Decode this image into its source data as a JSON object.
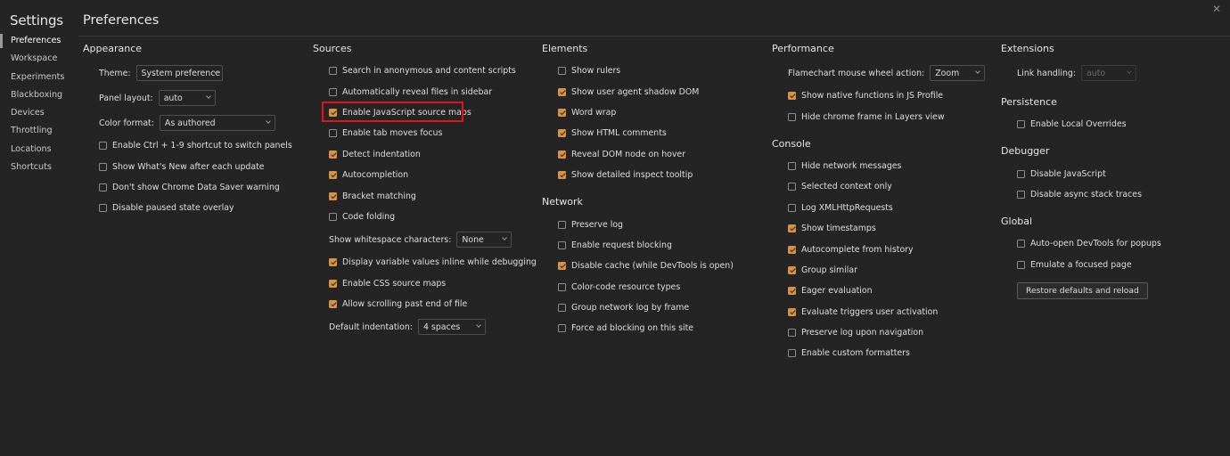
{
  "sidebar": {
    "title": "Settings",
    "items": [
      {
        "label": "Preferences",
        "active": true
      },
      {
        "label": "Workspace"
      },
      {
        "label": "Experiments"
      },
      {
        "label": "Blackboxing"
      },
      {
        "label": "Devices"
      },
      {
        "label": "Throttling"
      },
      {
        "label": "Locations"
      },
      {
        "label": "Shortcuts"
      }
    ]
  },
  "header": {
    "title": "Preferences",
    "close_icon": "close-icon"
  },
  "columns": [
    {
      "sections": [
        {
          "title": "Appearance",
          "rows": [
            {
              "type": "select",
              "label": "Theme:",
              "value": "System preference"
            },
            {
              "type": "select",
              "label": "Panel layout:",
              "value": "auto"
            },
            {
              "type": "select",
              "label": "Color format:",
              "value": "As authored"
            },
            {
              "type": "checkbox",
              "label": "Enable Ctrl + 1-9 shortcut to switch panels",
              "checked": false
            },
            {
              "type": "checkbox",
              "label": "Show What's New after each update",
              "checked": false
            },
            {
              "type": "checkbox",
              "label": "Don't show Chrome Data Saver warning",
              "checked": false
            },
            {
              "type": "checkbox",
              "label": "Disable paused state overlay",
              "checked": false
            }
          ]
        }
      ]
    },
    {
      "sections": [
        {
          "title": "Sources",
          "rows": [
            {
              "type": "checkbox",
              "label": "Search in anonymous and content scripts",
              "checked": false
            },
            {
              "type": "checkbox",
              "label": "Automatically reveal files in sidebar",
              "checked": false
            },
            {
              "type": "checkbox",
              "label": "Enable JavaScript source maps",
              "checked": true,
              "highlighted": true
            },
            {
              "type": "checkbox",
              "label": "Enable tab moves focus",
              "checked": false
            },
            {
              "type": "checkbox",
              "label": "Detect indentation",
              "checked": true
            },
            {
              "type": "checkbox",
              "label": "Autocompletion",
              "checked": true
            },
            {
              "type": "checkbox",
              "label": "Bracket matching",
              "checked": true
            },
            {
              "type": "checkbox",
              "label": "Code folding",
              "checked": false
            },
            {
              "type": "select",
              "label": "Show whitespace characters:",
              "value": "None"
            },
            {
              "type": "checkbox",
              "label": "Display variable values inline while debugging",
              "checked": true
            },
            {
              "type": "checkbox",
              "label": "Enable CSS source maps",
              "checked": true
            },
            {
              "type": "checkbox",
              "label": "Allow scrolling past end of file",
              "checked": true
            },
            {
              "type": "select",
              "label": "Default indentation:",
              "value": "4 spaces"
            }
          ]
        }
      ]
    },
    {
      "sections": [
        {
          "title": "Elements",
          "rows": [
            {
              "type": "checkbox",
              "label": "Show rulers",
              "checked": false
            },
            {
              "type": "checkbox",
              "label": "Show user agent shadow DOM",
              "checked": true
            },
            {
              "type": "checkbox",
              "label": "Word wrap",
              "checked": true
            },
            {
              "type": "checkbox",
              "label": "Show HTML comments",
              "checked": true
            },
            {
              "type": "checkbox",
              "label": "Reveal DOM node on hover",
              "checked": true
            },
            {
              "type": "checkbox",
              "label": "Show detailed inspect tooltip",
              "checked": true
            }
          ]
        },
        {
          "title": "Network",
          "rows": [
            {
              "type": "checkbox",
              "label": "Preserve log",
              "checked": false
            },
            {
              "type": "checkbox",
              "label": "Enable request blocking",
              "checked": false
            },
            {
              "type": "checkbox",
              "label": "Disable cache (while DevTools is open)",
              "checked": true
            },
            {
              "type": "checkbox",
              "label": "Color-code resource types",
              "checked": false
            },
            {
              "type": "checkbox",
              "label": "Group network log by frame",
              "checked": false
            },
            {
              "type": "checkbox",
              "label": "Force ad blocking on this site",
              "checked": false
            }
          ]
        }
      ]
    },
    {
      "sections": [
        {
          "title": "Performance",
          "rows": [
            {
              "type": "select",
              "label": "Flamechart mouse wheel action:",
              "value": "Zoom"
            },
            {
              "type": "checkbox",
              "label": "Show native functions in JS Profile",
              "checked": true
            },
            {
              "type": "checkbox",
              "label": "Hide chrome frame in Layers view",
              "checked": false
            }
          ]
        },
        {
          "title": "Console",
          "rows": [
            {
              "type": "checkbox",
              "label": "Hide network messages",
              "checked": false
            },
            {
              "type": "checkbox",
              "label": "Selected context only",
              "checked": false
            },
            {
              "type": "checkbox",
              "label": "Log XMLHttpRequests",
              "checked": false
            },
            {
              "type": "checkbox",
              "label": "Show timestamps",
              "checked": true
            },
            {
              "type": "checkbox",
              "label": "Autocomplete from history",
              "checked": true
            },
            {
              "type": "checkbox",
              "label": "Group similar",
              "checked": true
            },
            {
              "type": "checkbox",
              "label": "Eager evaluation",
              "checked": true
            },
            {
              "type": "checkbox",
              "label": "Evaluate triggers user activation",
              "checked": true
            },
            {
              "type": "checkbox",
              "label": "Preserve log upon navigation",
              "checked": false
            },
            {
              "type": "checkbox",
              "label": "Enable custom formatters",
              "checked": false
            }
          ]
        }
      ]
    },
    {
      "sections": [
        {
          "title": "Extensions",
          "rows": [
            {
              "type": "select",
              "label": "Link handling:",
              "value": "auto",
              "disabled": true
            }
          ]
        },
        {
          "title": "Persistence",
          "rows": [
            {
              "type": "checkbox",
              "label": "Enable Local Overrides",
              "checked": false
            }
          ]
        },
        {
          "title": "Debugger",
          "rows": [
            {
              "type": "checkbox",
              "label": "Disable JavaScript",
              "checked": false
            },
            {
              "type": "checkbox",
              "label": "Disable async stack traces",
              "checked": false
            }
          ]
        },
        {
          "title": "Global",
          "rows": [
            {
              "type": "checkbox",
              "label": "Auto-open DevTools for popups",
              "checked": false
            },
            {
              "type": "checkbox",
              "label": "Emulate a focused page",
              "checked": false
            }
          ],
          "button": "Restore defaults and reload"
        }
      ]
    }
  ],
  "colors": {
    "background": "#242424",
    "checkbox_checked": "#d9933f",
    "highlight_box": "#e0141c"
  }
}
